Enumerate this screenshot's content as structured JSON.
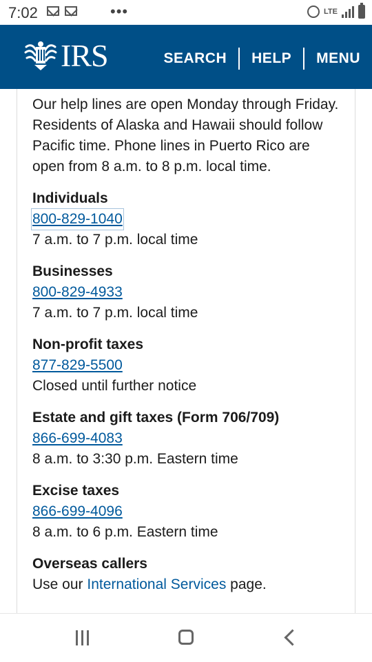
{
  "status_bar": {
    "time": "7:02",
    "more": "•••",
    "network": "LTE"
  },
  "header": {
    "logo_text": "IRS",
    "nav": [
      {
        "label": "SEARCH"
      },
      {
        "label": "HELP"
      },
      {
        "label": "MENU"
      }
    ]
  },
  "content": {
    "intro": "Our help lines are open Monday through Friday. Residents of Alaska and Hawaii should follow Pacific time. Phone lines in Puerto Rico are open from 8 a.m. to 8 p.m. local time.",
    "sections": [
      {
        "title": "Individuals",
        "phone": "800-829-1040",
        "hours": "7 a.m. to 7 p.m. local time"
      },
      {
        "title": "Businesses",
        "phone": "800-829-4933",
        "hours": "7 a.m. to 7 p.m. local time"
      },
      {
        "title": "Non-profit taxes",
        "phone": "877-829-5500",
        "hours": "Closed until further notice"
      },
      {
        "title": "Estate and gift taxes (Form 706/709)",
        "phone": "866-699-4083",
        "hours": "8 a.m. to 3:30 p.m. Eastern time"
      },
      {
        "title": "Excise taxes",
        "phone": "866-699-4096",
        "hours": "8 a.m. to 6 p.m. Eastern time"
      }
    ],
    "overseas": {
      "title": "Overseas callers",
      "prefix": "Use our ",
      "link": "International Services",
      "suffix": " page."
    }
  },
  "colors": {
    "header_bg": "#004f87",
    "link": "#00599c"
  }
}
